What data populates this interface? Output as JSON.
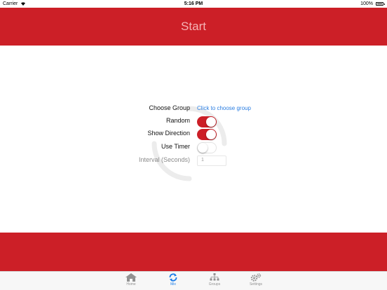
{
  "status_bar": {
    "carrier": "Carrier",
    "time": "5:16 PM",
    "battery": "100%"
  },
  "header": {
    "title": "Start"
  },
  "form": {
    "choose_group_label": "Choose Group",
    "choose_group_link": "Click to choose group",
    "random_label": "Random",
    "random_on": true,
    "show_direction_label": "Show Direction",
    "show_direction_on": true,
    "use_timer_label": "Use Timer",
    "use_timer_on": false,
    "interval_label": "Interval (Seconds)",
    "interval_value": "1"
  },
  "tabs": [
    {
      "label": "Home",
      "icon": "home-icon",
      "active": false
    },
    {
      "label": "Mix",
      "icon": "shuffle-icon",
      "active": true
    },
    {
      "label": "Groups",
      "icon": "groups-icon",
      "active": false
    },
    {
      "label": "Settings",
      "icon": "gears-icon",
      "active": false
    }
  ],
  "colors": {
    "brand_red": "#cc1f27",
    "header_title": "#f5b3b5",
    "link_blue": "#2a7de1",
    "tab_active": "#1b7ce8",
    "tab_inactive": "#929292"
  }
}
